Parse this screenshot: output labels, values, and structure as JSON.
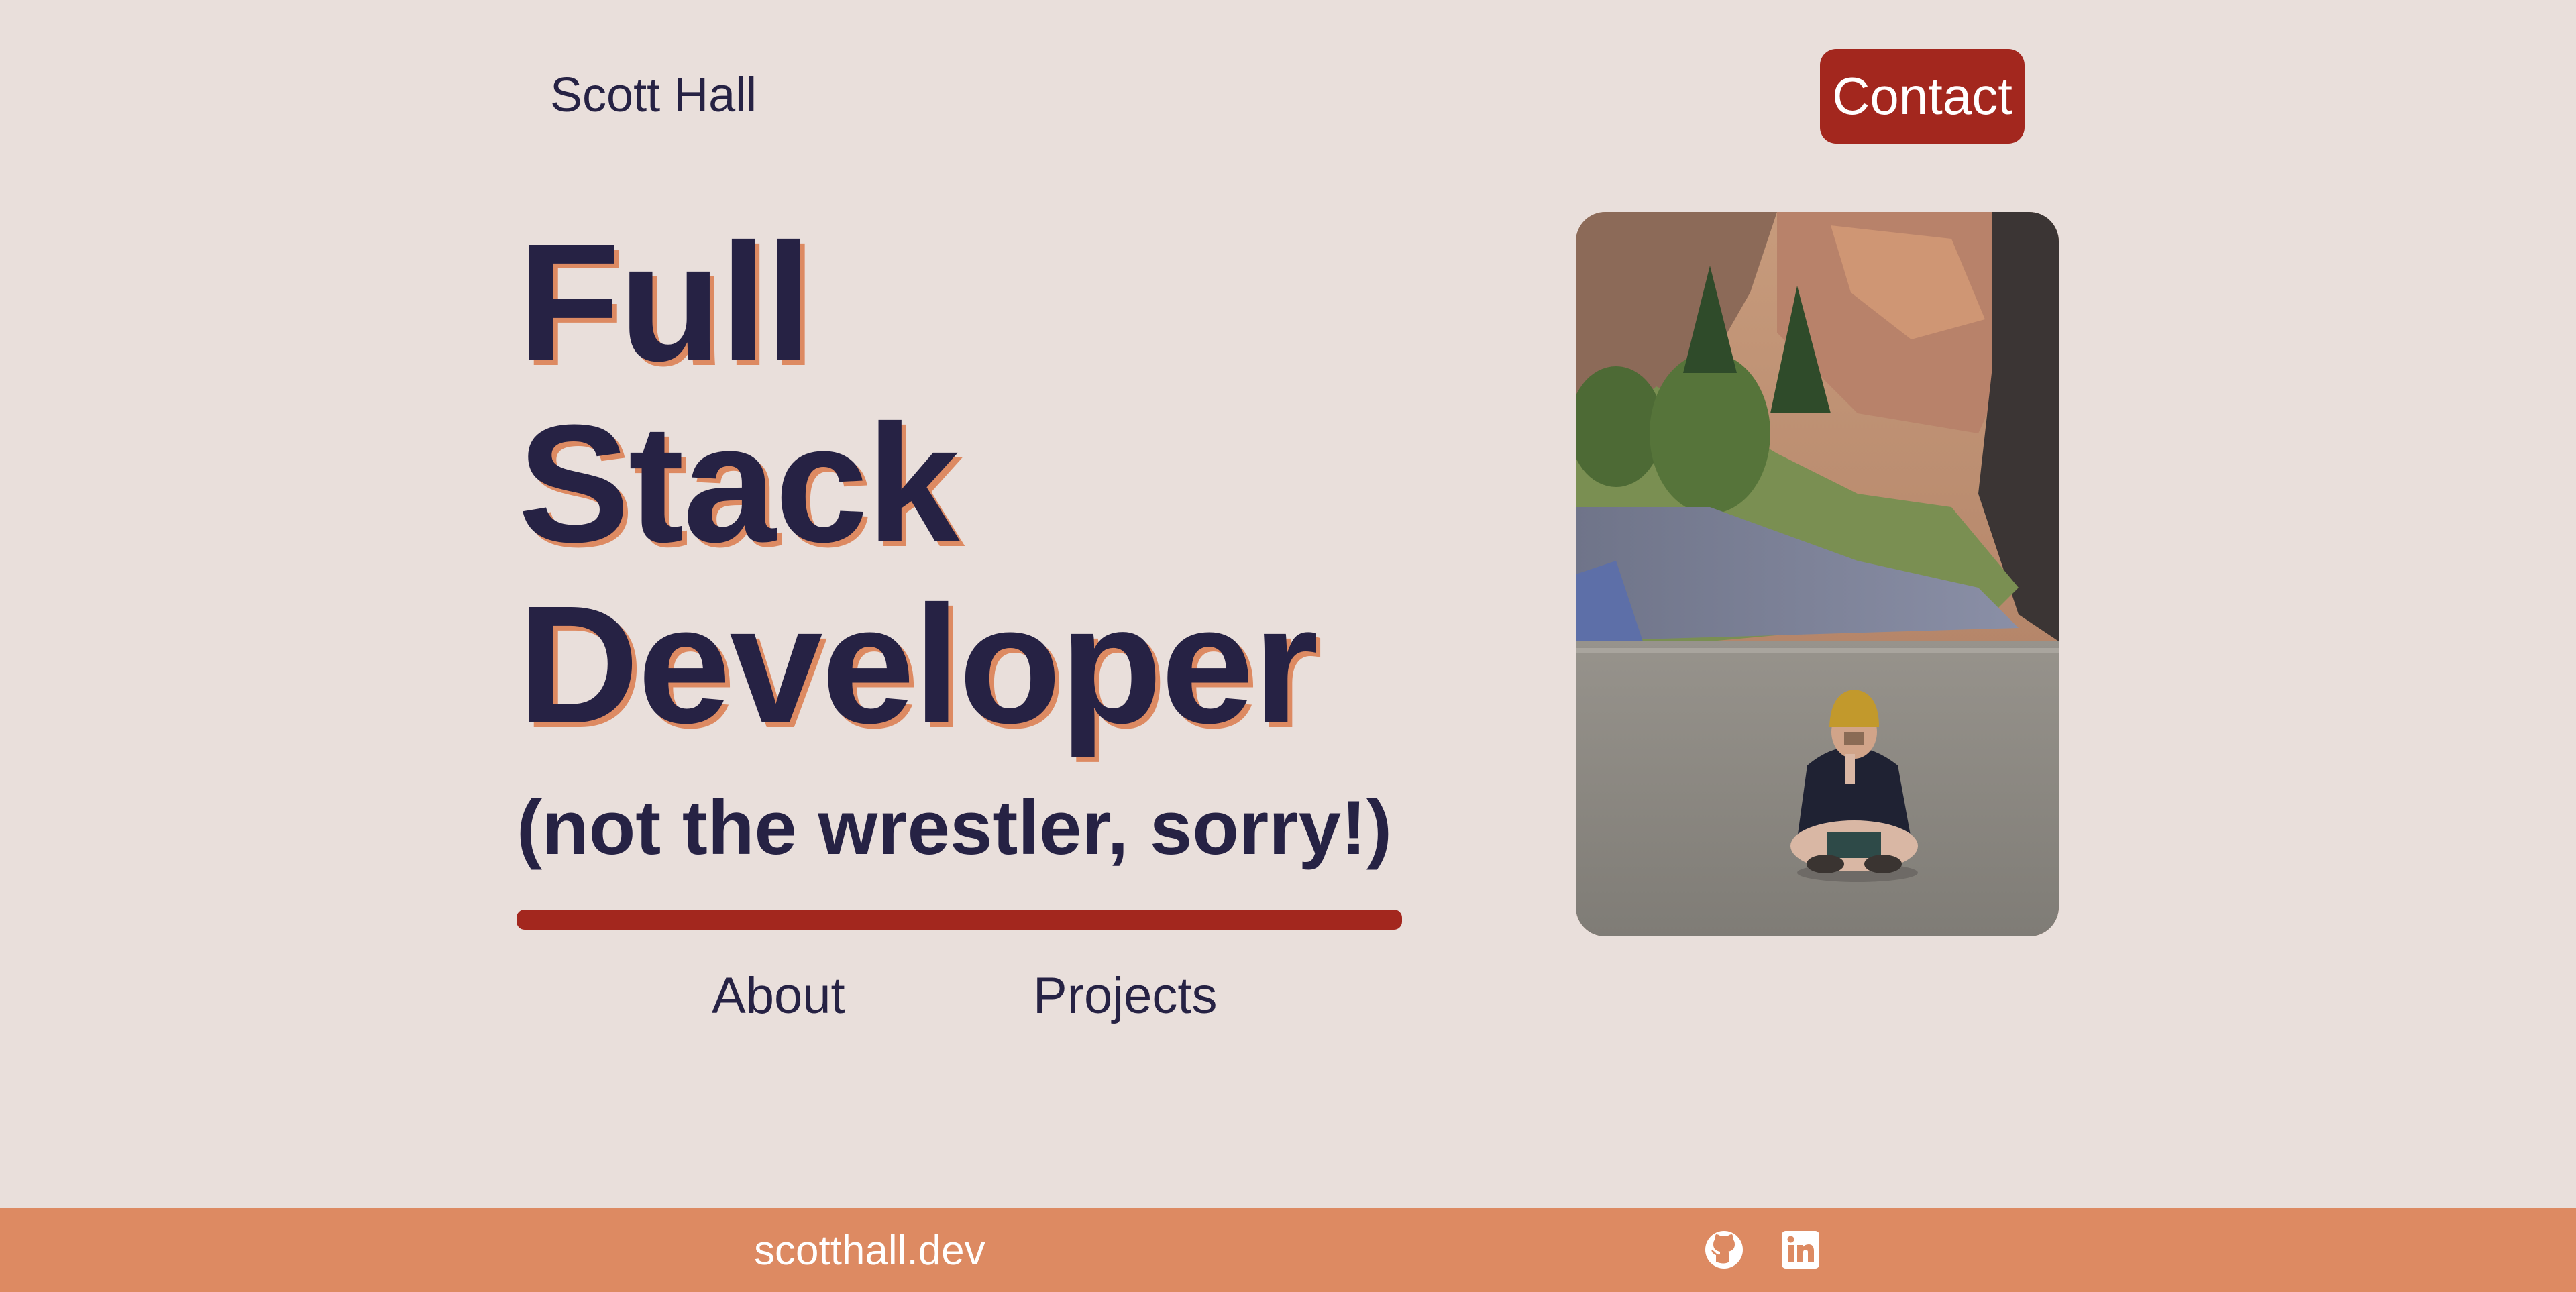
{
  "header": {
    "brand": "Scott Hall",
    "contact_label": "Contact"
  },
  "hero": {
    "headline": [
      "Full",
      "Stack",
      "Developer"
    ],
    "tagline": "(not the wrestler, sorry!)",
    "nav": [
      {
        "label": "About"
      },
      {
        "label": "Projects"
      }
    ],
    "photo_icon": "portrait-photo"
  },
  "footer": {
    "domain": "scotthall.dev",
    "social": [
      {
        "icon": "github-icon"
      },
      {
        "icon": "linkedin-icon"
      }
    ]
  },
  "colors": {
    "background": "#e9dfdb",
    "text": "#262244",
    "accent_red": "#a3271e",
    "accent_orange": "#dd8a62"
  }
}
